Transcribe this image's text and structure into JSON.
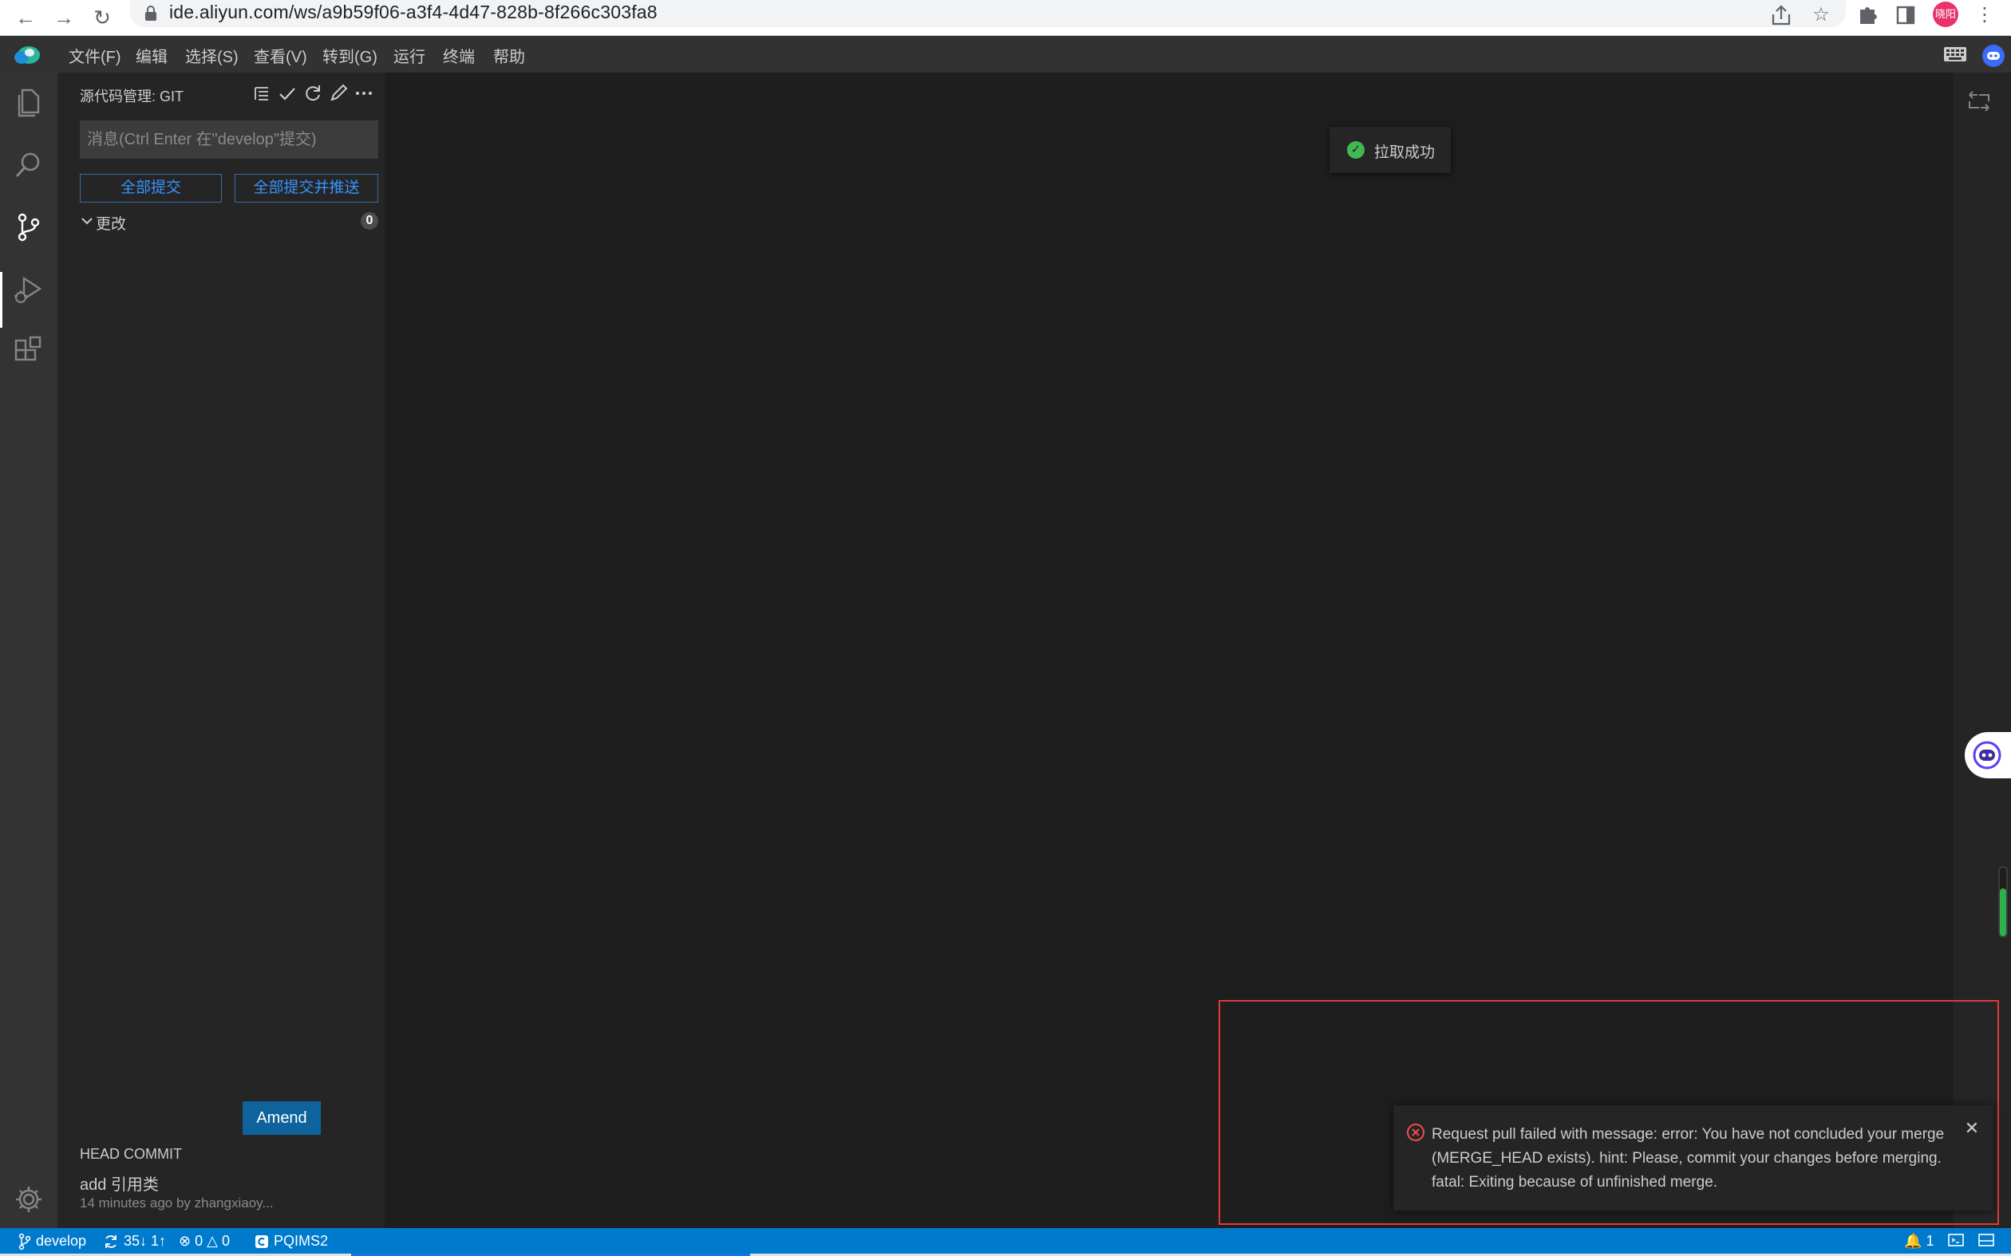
{
  "browser": {
    "url": "ide.aliyun.com/ws/a9b59f06-a3f4-4d47-828b-8f266c303fa8",
    "avatar_text": "晓阳",
    "icons": [
      "back-icon",
      "forward-icon",
      "reload-icon",
      "lock-icon",
      "share-icon",
      "star-icon",
      "extensions-icon",
      "sidepanel-icon",
      "more-vert-icon"
    ]
  },
  "menu": {
    "items": [
      "文件(F)",
      "编辑",
      "选择(S)",
      "查看(V)",
      "转到(G)",
      "运行",
      "终端",
      "帮助"
    ]
  },
  "activity": {
    "icons": [
      "explorer-icon",
      "search-icon",
      "source-control-icon",
      "run-debug-icon",
      "extensions-icon",
      "settings-gear-icon"
    ],
    "active": "source-control-icon"
  },
  "scm": {
    "title": "源代码管理: GIT",
    "message_placeholder": "消息(Ctrl Enter 在\"develop\"提交)",
    "commit_all_label": "全部提交",
    "commit_push_label": "全部提交并推送",
    "changes_label": "更改",
    "changes_count": "0",
    "head_commit_title": "HEAD COMMIT",
    "head_commit_message": "add 引用类",
    "head_commit_meta": "14 minutes ago by zhangxiaoy...",
    "amend_label": "Amend"
  },
  "toast": {
    "text": "拉取成功"
  },
  "notification": {
    "type": "error",
    "message": "Request pull failed with message: error: You have not concluded your merge (MERGE_HEAD exists). hint: Please, commit your changes before merging. fatal: Exiting because of unfinished merge."
  },
  "status": {
    "branch": "develop",
    "sync": "35↓ 1↑",
    "errors": "0",
    "warnings": "0",
    "project": "PQIMS2",
    "notifications": "1"
  },
  "colors": {
    "accent": "#007acc",
    "error": "#f14c4c",
    "success": "#3fb950"
  }
}
